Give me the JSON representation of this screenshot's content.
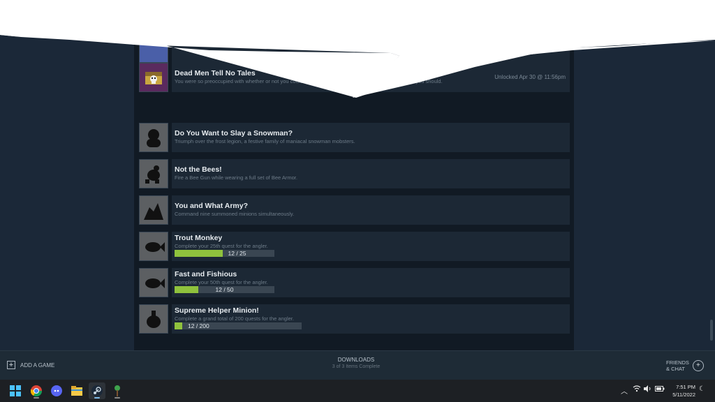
{
  "achievements_partial_top": {
    "icon": "partial-achievement-icon"
  },
  "achievements": [
    {
      "title": "Dead Men Tell No Tales",
      "description": "You were so preoccupied with whether or not you could open the chest that y",
      "description_tail": "you should.",
      "unlocked": "Unlocked Apr 30 @ 11:56pm",
      "icon": "treasure-chest-icon"
    },
    {
      "title": "Do You Want to Slay a Snowman?",
      "description": "Triumph over the frost legion, a festive family of maniacal snowman mobsters.",
      "icon": "locked-snowman-icon"
    },
    {
      "title": "Not the Bees!",
      "description": "Fire a Bee Gun while wearing a full set of Bee Armor.",
      "icon": "locked-bee-icon"
    },
    {
      "title": "You and What Army?",
      "description": "Command nine summoned minions simultaneously.",
      "icon": "locked-army-icon"
    },
    {
      "title": "Trout Monkey",
      "description": "Complete your 25th quest for the angler.",
      "progress_text": "12 / 25",
      "progress": 0.48,
      "icon": "locked-fish-icon"
    },
    {
      "title": "Fast and Fishious",
      "description": "Complete your 50th quest for the angler.",
      "progress_text": "12 / 50",
      "progress": 0.24,
      "icon": "locked-fish-icon"
    },
    {
      "title": "Supreme Helper Minion!",
      "description": "Complete a grand total of 200 quests for the angler.",
      "progress_text": "12 / 200",
      "progress": 0.06,
      "icon": "locked-minion-icon"
    }
  ],
  "bottom_bar": {
    "add_game": "ADD A GAME",
    "downloads_title": "DOWNLOADS",
    "downloads_status": "3 of 3 Items Complete",
    "friends_line1": "FRIENDS",
    "friends_line2": "& CHAT"
  },
  "taskbar": {
    "apps": [
      "windows-start-icon",
      "chrome-icon",
      "discord-icon",
      "file-explorer-icon",
      "steam-icon",
      "terraria-tree-icon"
    ],
    "time": "7:51 PM",
    "date": "5/11/2022"
  },
  "colors": {
    "progress_fill": "#8fc23d",
    "row_background": "#1c2835",
    "accent": "#7cb9e8"
  }
}
